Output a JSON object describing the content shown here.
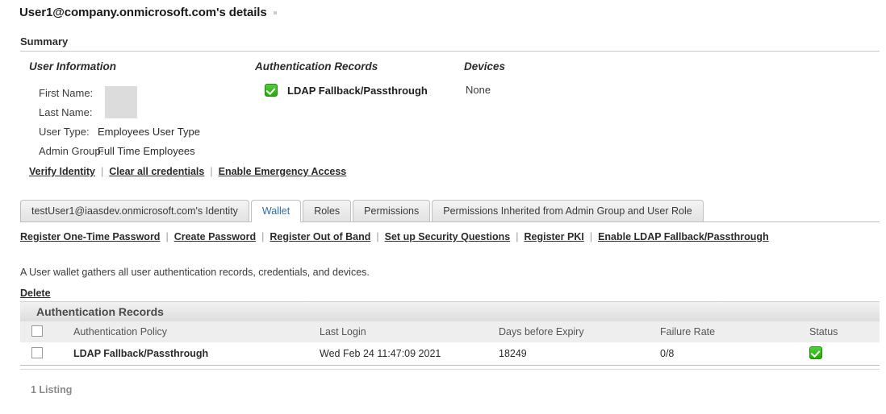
{
  "page": {
    "title": "User1@company.onmicrosoft.com's details",
    "summary_heading": "Summary"
  },
  "user_information": {
    "heading": "User Information",
    "rows": [
      {
        "label": "First Name:",
        "value": ""
      },
      {
        "label": "Last Name:",
        "value": ""
      },
      {
        "label": "User Type:",
        "value": "Employees User Type"
      },
      {
        "label": "Admin Group:",
        "value": "Full Time Employees"
      }
    ],
    "links": [
      {
        "label": "Verify Identity"
      },
      {
        "label": "Clear all credentials"
      },
      {
        "label": "Enable Emergency Access"
      }
    ]
  },
  "authentication_records_summary": {
    "heading": "Authentication Records",
    "items": [
      {
        "icon": "green-check-icon",
        "label": "LDAP Fallback/Passthrough"
      }
    ]
  },
  "devices": {
    "heading": "Devices",
    "value": "None"
  },
  "tabs": [
    {
      "label": "testUser1@iaasdev.onmicrosoft.com's Identity",
      "active": false
    },
    {
      "label": "Wallet",
      "active": true
    },
    {
      "label": "Roles",
      "active": false
    },
    {
      "label": "Permissions",
      "active": false
    },
    {
      "label": "Permissions Inherited from Admin Group and User Role",
      "active": false
    }
  ],
  "action_links": [
    {
      "label": "Register One-Time Password"
    },
    {
      "label": "Create Password"
    },
    {
      "label": "Register Out of Band"
    },
    {
      "label": "Set up Security Questions"
    },
    {
      "label": "Register PKI"
    },
    {
      "label": "Enable LDAP Fallback/Passthrough"
    }
  ],
  "wallet": {
    "description": "A User wallet gathers all user authentication records, credentials, and devices.",
    "delete_label": "Delete",
    "table_caption": "Authentication Records",
    "columns": [
      "",
      "Authentication Policy",
      "Last Login",
      "Days before Expiry",
      "Failure Rate",
      "Status"
    ],
    "rows": [
      {
        "selected": false,
        "policy": "LDAP Fallback/Passthrough",
        "last_login": "Wed Feb 24 11:47:09 2021",
        "days_before_expiry": "18249",
        "failure_rate": "0/8",
        "status_icon": "green-check-icon"
      }
    ],
    "listing_count": "1 Listing"
  },
  "colors": {
    "accent_link": "#2b2b2b",
    "active_tab_text": "#2f6fa8",
    "status_green": "#27a909"
  }
}
